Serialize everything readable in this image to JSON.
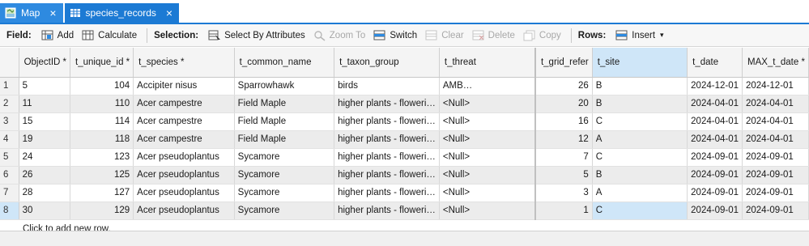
{
  "tabs": [
    {
      "label": "Map",
      "icon": "map-icon",
      "active": false
    },
    {
      "label": "species_records",
      "icon": "table-icon",
      "active": true
    }
  ],
  "ribbon": {
    "field_label": "Field:",
    "add": "Add",
    "calculate": "Calculate",
    "selection_label": "Selection:",
    "select_by_attributes": "Select By Attributes",
    "zoom_to": "Zoom To",
    "switch": "Switch",
    "clear": "Clear",
    "delete": "Delete",
    "copy": "Copy",
    "rows_label": "Rows:",
    "insert": "Insert"
  },
  "table": {
    "columns": [
      "ObjectID *",
      "t_unique_id *",
      "t_species *",
      "t_common_name",
      "t_taxon_group",
      "t_threat",
      "t_grid_refer",
      "t_site",
      "t_date",
      "MAX_t_date *"
    ],
    "rows": [
      {
        "n": "1",
        "cells": [
          "5",
          "104",
          "Accipiter nisus",
          "Sparrowhawk",
          "birds",
          "AMB…",
          "26",
          "B",
          "2024-12-01",
          "2024-12-01"
        ]
      },
      {
        "n": "2",
        "cells": [
          "11",
          "110",
          "Acer campestre",
          "Field Maple",
          "higher plants - floweri…",
          "<Null>",
          "20",
          "B",
          "2024-04-01",
          "2024-04-01"
        ]
      },
      {
        "n": "3",
        "cells": [
          "15",
          "114",
          "Acer campestre",
          "Field Maple",
          "higher plants - floweri…",
          "<Null>",
          "16",
          "C",
          "2024-04-01",
          "2024-04-01"
        ]
      },
      {
        "n": "4",
        "cells": [
          "19",
          "118",
          "Acer campestre",
          "Field Maple",
          "higher plants - floweri…",
          "<Null>",
          "12",
          "A",
          "2024-04-01",
          "2024-04-01"
        ]
      },
      {
        "n": "5",
        "cells": [
          "24",
          "123",
          "Acer pseudoplantus",
          "Sycamore",
          "higher plants - floweri…",
          "<Null>",
          "7",
          "C",
          "2024-09-01",
          "2024-09-01"
        ]
      },
      {
        "n": "6",
        "cells": [
          "26",
          "125",
          "Acer pseudoplantus",
          "Sycamore",
          "higher plants - floweri…",
          "<Null>",
          "5",
          "B",
          "2024-09-01",
          "2024-09-01"
        ]
      },
      {
        "n": "7",
        "cells": [
          "28",
          "127",
          "Acer pseudoplantus",
          "Sycamore",
          "higher plants - floweri…",
          "<Null>",
          "3",
          "A",
          "2024-09-01",
          "2024-09-01"
        ]
      },
      {
        "n": "8",
        "cells": [
          "30",
          "129",
          "Acer pseudoplantus",
          "Sycamore",
          "higher plants - floweri…",
          "<Null>",
          "1",
          "C",
          "2024-09-01",
          "2024-09-01"
        ]
      }
    ],
    "add_row_text": "Click to add new row."
  },
  "colors": {
    "accent": "#1c7ad4",
    "selected": "#cfe6f8"
  }
}
